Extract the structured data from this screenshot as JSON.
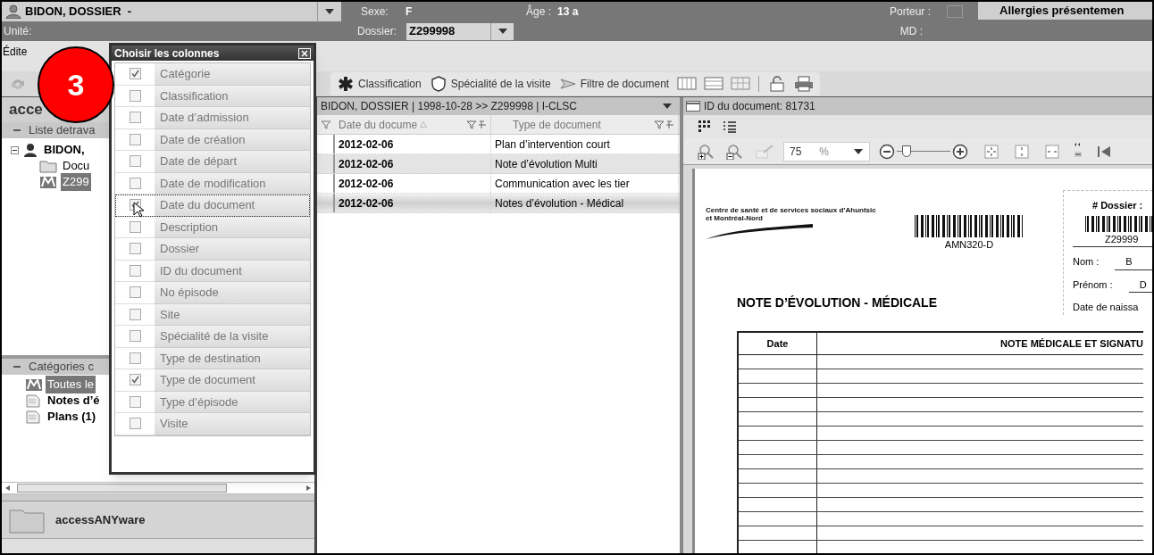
{
  "header": {
    "patient": "BIDON, DOSSIER  -",
    "sex_label": "Sexe:",
    "sex": "F",
    "age_label": "Âge :",
    "age": "13 a",
    "porteur_label": "Porteur :",
    "porteur_checked": false,
    "allergies": "Allergies présentemen",
    "unit_label": "Unité:",
    "dossier_label": "Dossier:",
    "dossier": "Z299998",
    "md_label": "MD :"
  },
  "menu": [
    "Édite"
  ],
  "toolbar": [
    {
      "label": "Classification"
    },
    {
      "label": "Spécialité de la visite"
    },
    {
      "label": "Filtre de document"
    }
  ],
  "badge": "3",
  "left_panel": {
    "title": "acce",
    "worklist": {
      "label": "Liste detrava",
      "expanded": true,
      "tree": [
        {
          "label": "BIDON,",
          "selected": false,
          "expanded": true,
          "children": [
            {
              "label": "Docu",
              "selected": false
            },
            {
              "label": "Z299",
              "selected": true
            }
          ]
        }
      ]
    },
    "categories": {
      "label": "Catégories c",
      "expanded": true,
      "items": [
        {
          "label": "Toutes le",
          "selected": true
        },
        {
          "label": "Notes d’é",
          "selected": false
        },
        {
          "label": "Plans (1)",
          "selected": false
        }
      ]
    },
    "nav": [
      {
        "label": "accessANYware"
      }
    ]
  },
  "column_chooser": {
    "title": "Choisir les colonnes",
    "items": [
      {
        "label": "Catégorie",
        "checked": true,
        "focused": false
      },
      {
        "label": "Classification",
        "checked": false,
        "focused": false
      },
      {
        "label": "Date d’admission",
        "checked": false,
        "focused": false
      },
      {
        "label": "Date de création",
        "checked": false,
        "focused": false
      },
      {
        "label": "Date de départ",
        "checked": false,
        "focused": false
      },
      {
        "label": "Date de modification",
        "checked": false,
        "focused": false
      },
      {
        "label": "Date du document",
        "checked": true,
        "focused": true
      },
      {
        "label": "Description",
        "checked": false,
        "focused": false
      },
      {
        "label": "Dossier",
        "checked": false,
        "focused": false
      },
      {
        "label": "ID du document",
        "checked": false,
        "focused": false
      },
      {
        "label": "No épisode",
        "checked": false,
        "focused": false
      },
      {
        "label": "Site",
        "checked": false,
        "focused": false
      },
      {
        "label": "Spécialité de la visite",
        "checked": false,
        "focused": false
      },
      {
        "label": "Type de destination",
        "checked": false,
        "focused": false
      },
      {
        "label": "Type de document",
        "checked": true,
        "focused": false
      },
      {
        "label": "Type d’épisode",
        "checked": false,
        "focused": false
      },
      {
        "label": "Visite",
        "checked": false,
        "focused": false
      }
    ]
  },
  "documents": {
    "title": "BIDON, DOSSIER | 1998-10-28 >> Z299998 | I-CLSC",
    "columns": [
      "Date du docume",
      "Type de document"
    ],
    "rows": [
      {
        "cells": [
          "2012-02-06",
          "Plan d’intervention court"
        ],
        "selected": false
      },
      {
        "cells": [
          "2012-02-06",
          "Note d’évolution Multi"
        ],
        "selected": false
      },
      {
        "cells": [
          "2012-02-06",
          "Communication avec les tier"
        ],
        "selected": false
      },
      {
        "cells": [
          "2012-02-06",
          "Notes d’évolution - Médical"
        ],
        "selected": true
      }
    ]
  },
  "viewer": {
    "title": "ID du document: 81731",
    "zoom": "75",
    "zoom_unit": "%",
    "zoom_slider": {
      "level": 0.12
    },
    "document": {
      "org": "Centre de santé et de services sociaux d’Ahuntsic et Montréal-Nord",
      "barcode_label": "AMN320-D",
      "dossier_label": "# Dossier :",
      "dossier": "Z29999",
      "fields": [
        {
          "label": "Nom :",
          "value": "B"
        },
        {
          "label": "Prénom :",
          "value": "D"
        }
      ],
      "birth_label": "Date de naissa",
      "heading": "NOTE D’ÉVOLUTION - MÉDICALE",
      "table_columns": [
        "Date",
        "NOTE MÉDICALE ET SIGNATU"
      ]
    }
  }
}
